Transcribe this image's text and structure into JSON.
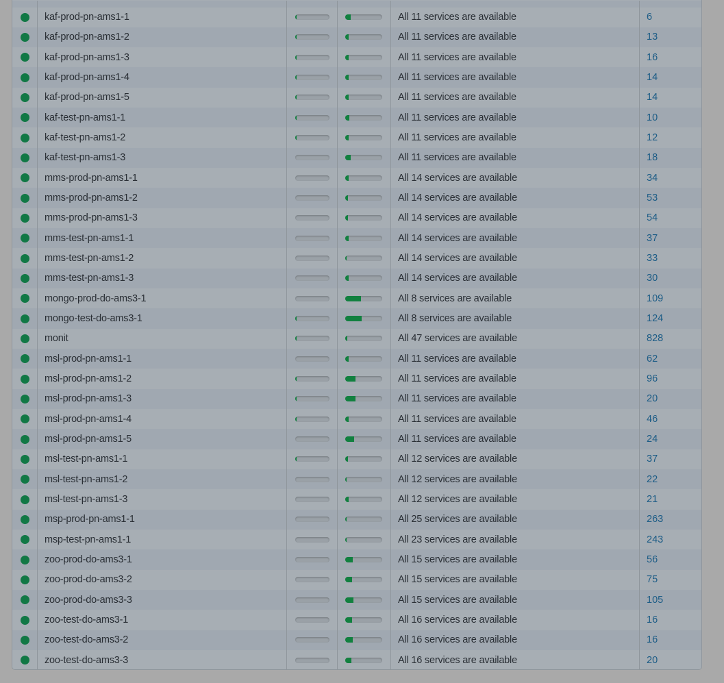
{
  "theme": {
    "status_ok": "#117845",
    "bar_fill": "#11803f",
    "link": "#1c5c86"
  },
  "rows": [
    {
      "name": "kaf-prod-pn-ams1-1",
      "cpu": 0.01,
      "mem": 0.15,
      "services": "All 11 services are available",
      "uptime": "6"
    },
    {
      "name": "kaf-prod-pn-ams1-2",
      "cpu": 0.01,
      "mem": 0.1,
      "services": "All 11 services are available",
      "uptime": "13"
    },
    {
      "name": "kaf-prod-pn-ams1-3",
      "cpu": 0.01,
      "mem": 0.1,
      "services": "All 11 services are available",
      "uptime": "16"
    },
    {
      "name": "kaf-prod-pn-ams1-4",
      "cpu": 0.01,
      "mem": 0.1,
      "services": "All 11 services are available",
      "uptime": "14"
    },
    {
      "name": "kaf-prod-pn-ams1-5",
      "cpu": 0.01,
      "mem": 0.1,
      "services": "All 11 services are available",
      "uptime": "14"
    },
    {
      "name": "kaf-test-pn-ams1-1",
      "cpu": 0.01,
      "mem": 0.12,
      "services": "All 11 services are available",
      "uptime": "10"
    },
    {
      "name": "kaf-test-pn-ams1-2",
      "cpu": 0.03,
      "mem": 0.1,
      "services": "All 11 services are available",
      "uptime": "12"
    },
    {
      "name": "kaf-test-pn-ams1-3",
      "cpu": 0.0,
      "mem": 0.14,
      "services": "All 11 services are available",
      "uptime": "18"
    },
    {
      "name": "mms-prod-pn-ams1-1",
      "cpu": 0.0,
      "mem": 0.1,
      "services": "All 14 services are available",
      "uptime": "34"
    },
    {
      "name": "mms-prod-pn-ams1-2",
      "cpu": 0.0,
      "mem": 0.07,
      "services": "All 14 services are available",
      "uptime": "53"
    },
    {
      "name": "mms-prod-pn-ams1-3",
      "cpu": 0.0,
      "mem": 0.07,
      "services": "All 14 services are available",
      "uptime": "54"
    },
    {
      "name": "mms-test-pn-ams1-1",
      "cpu": 0.0,
      "mem": 0.1,
      "services": "All 14 services are available",
      "uptime": "37"
    },
    {
      "name": "mms-test-pn-ams1-2",
      "cpu": 0.0,
      "mem": 0.04,
      "services": "All 14 services are available",
      "uptime": "33"
    },
    {
      "name": "mms-test-pn-ams1-3",
      "cpu": 0.0,
      "mem": 0.1,
      "services": "All 14 services are available",
      "uptime": "30"
    },
    {
      "name": "mongo-prod-do-ams3-1",
      "cpu": 0.0,
      "mem": 0.43,
      "services": "All 8 services are available",
      "uptime": "109"
    },
    {
      "name": "mongo-test-do-ams3-1",
      "cpu": 0.01,
      "mem": 0.45,
      "services": "All 8 services are available",
      "uptime": "124"
    },
    {
      "name": "monit",
      "cpu": 0.03,
      "mem": 0.06,
      "services": "All 47 services are available",
      "uptime": "828"
    },
    {
      "name": "msl-prod-pn-ams1-1",
      "cpu": 0.0,
      "mem": 0.1,
      "services": "All 11 services are available",
      "uptime": "62"
    },
    {
      "name": "msl-prod-pn-ams1-2",
      "cpu": 0.03,
      "mem": 0.28,
      "services": "All 11 services are available",
      "uptime": "96"
    },
    {
      "name": "msl-prod-pn-ams1-3",
      "cpu": 0.01,
      "mem": 0.28,
      "services": "All 11 services are available",
      "uptime": "20"
    },
    {
      "name": "msl-prod-pn-ams1-4",
      "cpu": 0.01,
      "mem": 0.1,
      "services": "All 11 services are available",
      "uptime": "46"
    },
    {
      "name": "msl-prod-pn-ams1-5",
      "cpu": 0.0,
      "mem": 0.24,
      "services": "All 11 services are available",
      "uptime": "24"
    },
    {
      "name": "msl-test-pn-ams1-1",
      "cpu": 0.01,
      "mem": 0.08,
      "services": "All 12 services are available",
      "uptime": "37"
    },
    {
      "name": "msl-test-pn-ams1-2",
      "cpu": 0.0,
      "mem": 0.03,
      "services": "All 12 services are available",
      "uptime": "22"
    },
    {
      "name": "msl-test-pn-ams1-3",
      "cpu": 0.0,
      "mem": 0.1,
      "services": "All 12 services are available",
      "uptime": "21"
    },
    {
      "name": "msp-prod-pn-ams1-1",
      "cpu": 0.0,
      "mem": 0.02,
      "services": "All 25 services are available",
      "uptime": "263"
    },
    {
      "name": "msp-test-pn-ams1-1",
      "cpu": 0.0,
      "mem": 0.02,
      "services": "All 23 services are available",
      "uptime": "243"
    },
    {
      "name": "zoo-prod-do-ams3-1",
      "cpu": 0.0,
      "mem": 0.2,
      "services": "All 15 services are available",
      "uptime": "56"
    },
    {
      "name": "zoo-prod-do-ams3-2",
      "cpu": 0.0,
      "mem": 0.18,
      "services": "All 15 services are available",
      "uptime": "75"
    },
    {
      "name": "zoo-prod-do-ams3-3",
      "cpu": 0.0,
      "mem": 0.22,
      "services": "All 15 services are available",
      "uptime": "105"
    },
    {
      "name": "zoo-test-do-ams3-1",
      "cpu": 0.0,
      "mem": 0.18,
      "services": "All 16 services are available",
      "uptime": "16"
    },
    {
      "name": "zoo-test-do-ams3-2",
      "cpu": 0.0,
      "mem": 0.2,
      "services": "All 16 services are available",
      "uptime": "16"
    },
    {
      "name": "zoo-test-do-ams3-3",
      "cpu": 0.0,
      "mem": 0.16,
      "services": "All 16 services are available",
      "uptime": "20"
    }
  ]
}
